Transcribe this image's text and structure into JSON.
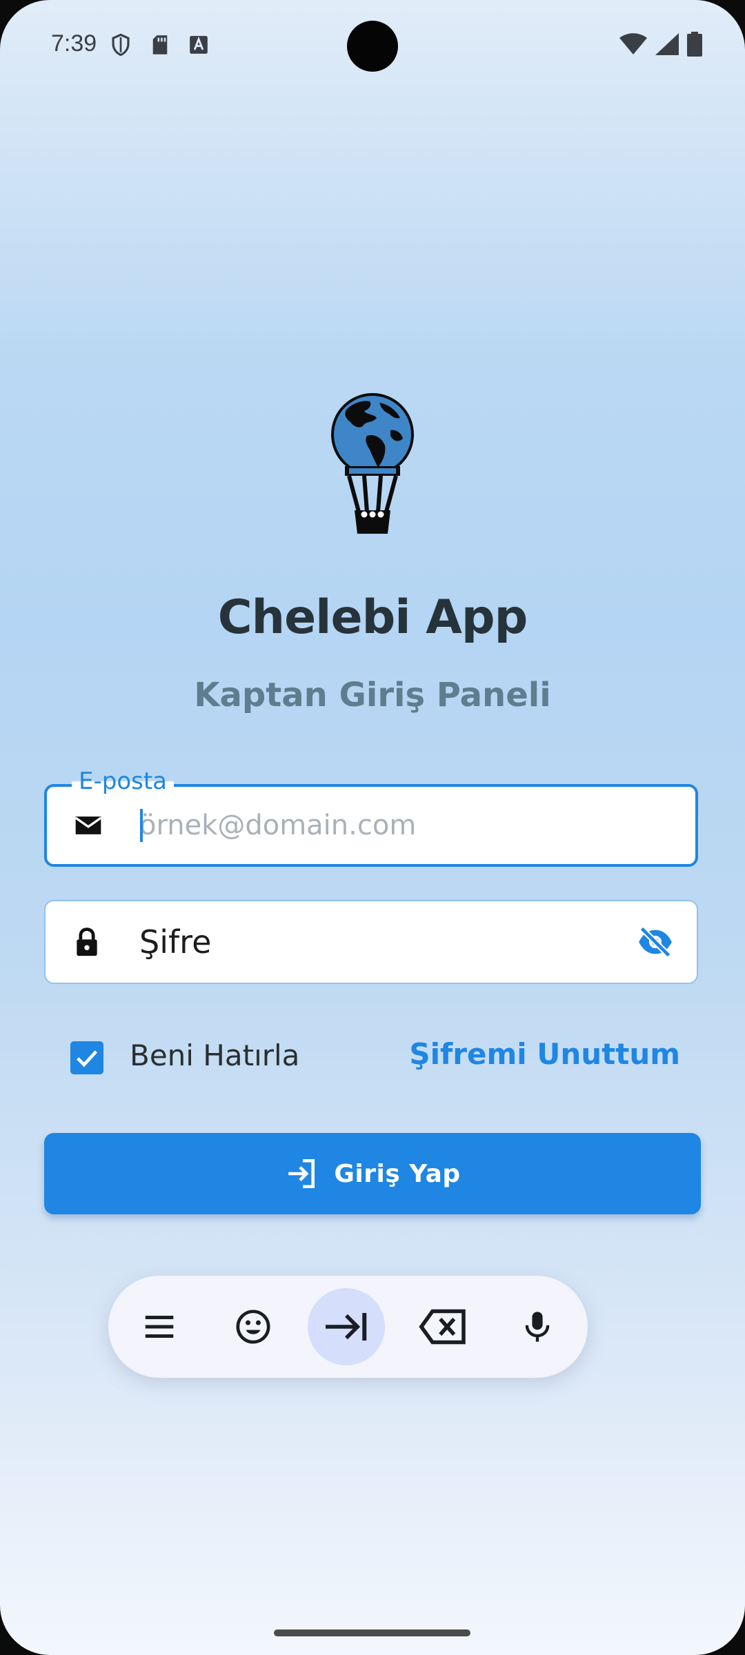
{
  "status_bar": {
    "time": "7:39",
    "left_icons": [
      "shield-icon",
      "sd-card-icon",
      "keyboard-a-icon"
    ],
    "right_icons": [
      "wifi-icon",
      "signal-icon",
      "battery-icon"
    ]
  },
  "app": {
    "title": "Chelebi App",
    "subtitle": "Kaptan Giriş Paneli",
    "logo_icon": "globe-balloon-icon"
  },
  "form": {
    "email": {
      "label": "E-posta",
      "placeholder": "örnek@domain.com",
      "value": "",
      "icon": "mail-icon"
    },
    "password": {
      "label": "Şifre",
      "icon": "lock-icon",
      "toggle_icon": "visibility-off-icon"
    },
    "remember_me": {
      "label": "Beni Hatırla",
      "checked": true
    },
    "forgot_password": "Şifremi Unuttum",
    "login_button": "Giriş Yap",
    "login_icon": "login-icon"
  },
  "keyboard_toolbar": {
    "buttons": [
      "menu-icon",
      "emoji-icon",
      "tab-icon",
      "backspace-icon",
      "mic-icon"
    ],
    "active": "tab-icon"
  },
  "colors": {
    "accent": "#1f86e3",
    "title": "#27333a",
    "subtitle": "#5e7d8e"
  }
}
